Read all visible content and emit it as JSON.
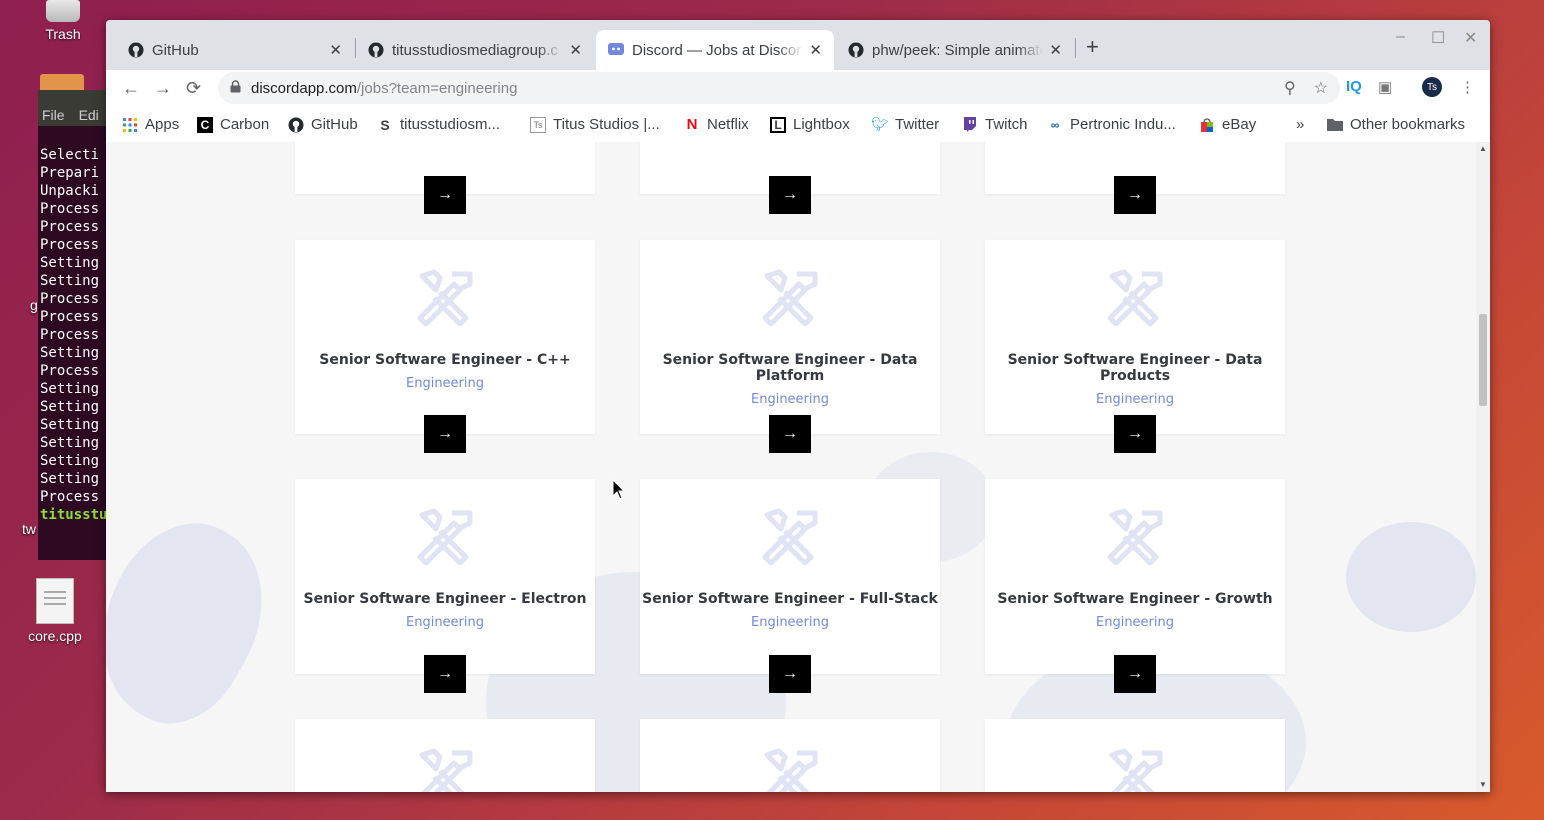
{
  "desktop": {
    "trash_label": "Trash",
    "core_file_label": "core.cpp",
    "tw_label": "tw",
    "g_label": "g"
  },
  "terminal": {
    "menu": [
      "File",
      "Edi"
    ],
    "lines": [
      "Selecti",
      "Prepari",
      "Unpacki",
      "Process",
      "Process",
      "Process",
      "Setting",
      "Setting",
      "Process",
      "Process",
      "Process",
      "Setting",
      "Process",
      "Setting",
      "Setting",
      "Setting",
      "Setting",
      "Setting",
      "Setting",
      "Process"
    ],
    "prompt": "titusstu"
  },
  "tabs": [
    {
      "title": "GitHub",
      "icon": "github-icon"
    },
    {
      "title": "titusstudiosmediagroup.c",
      "icon": "github-icon"
    },
    {
      "title": "Discord — Jobs at Discord",
      "icon": "discord-icon",
      "active": true
    },
    {
      "title": "phw/peek: Simple animate",
      "icon": "github-icon"
    }
  ],
  "address_bar": {
    "host": "discordapp.com",
    "path": "/jobs?team=engineering"
  },
  "bookmarks": [
    {
      "label": "Apps",
      "icon": "apps-grid-icon"
    },
    {
      "label": "Carbon",
      "icon": "carbon-icon"
    },
    {
      "label": "GitHub",
      "icon": "github-icon"
    },
    {
      "label": "titusstudiosm...",
      "icon": "s-icon"
    },
    {
      "label": "Titus Studios |...",
      "icon": "ts-icon"
    },
    {
      "label": "Netflix",
      "icon": "netflix-icon"
    },
    {
      "label": "Lightbox",
      "icon": "lightbox-icon"
    },
    {
      "label": "Twitter",
      "icon": "twitter-icon"
    },
    {
      "label": "Twitch",
      "icon": "twitch-icon"
    },
    {
      "label": "Pertronic Indu...",
      "icon": "link-icon"
    },
    {
      "label": "eBay",
      "icon": "ebay-icon"
    }
  ],
  "bookmarks_overflow": "»",
  "other_bookmarks": "Other bookmarks",
  "profile_initials": "Ts",
  "jobs": [
    {
      "title": "Senior Software Engineer - C++",
      "team": "Engineering"
    },
    {
      "title": "Senior Software Engineer - Data Platform",
      "team": "Engineering"
    },
    {
      "title": "Senior Software Engineer - Data Products",
      "team": "Engineering"
    },
    {
      "title": "Senior Software Engineer - Electron",
      "team": "Engineering"
    },
    {
      "title": "Senior Software Engineer - Full-Stack",
      "team": "Engineering"
    },
    {
      "title": "Senior Software Engineer - Growth",
      "team": "Engineering"
    }
  ],
  "arrow_glyph": "→",
  "colors": {
    "accent": "#7289da",
    "button": "#000000",
    "page_bg": "#f6f6f6"
  }
}
